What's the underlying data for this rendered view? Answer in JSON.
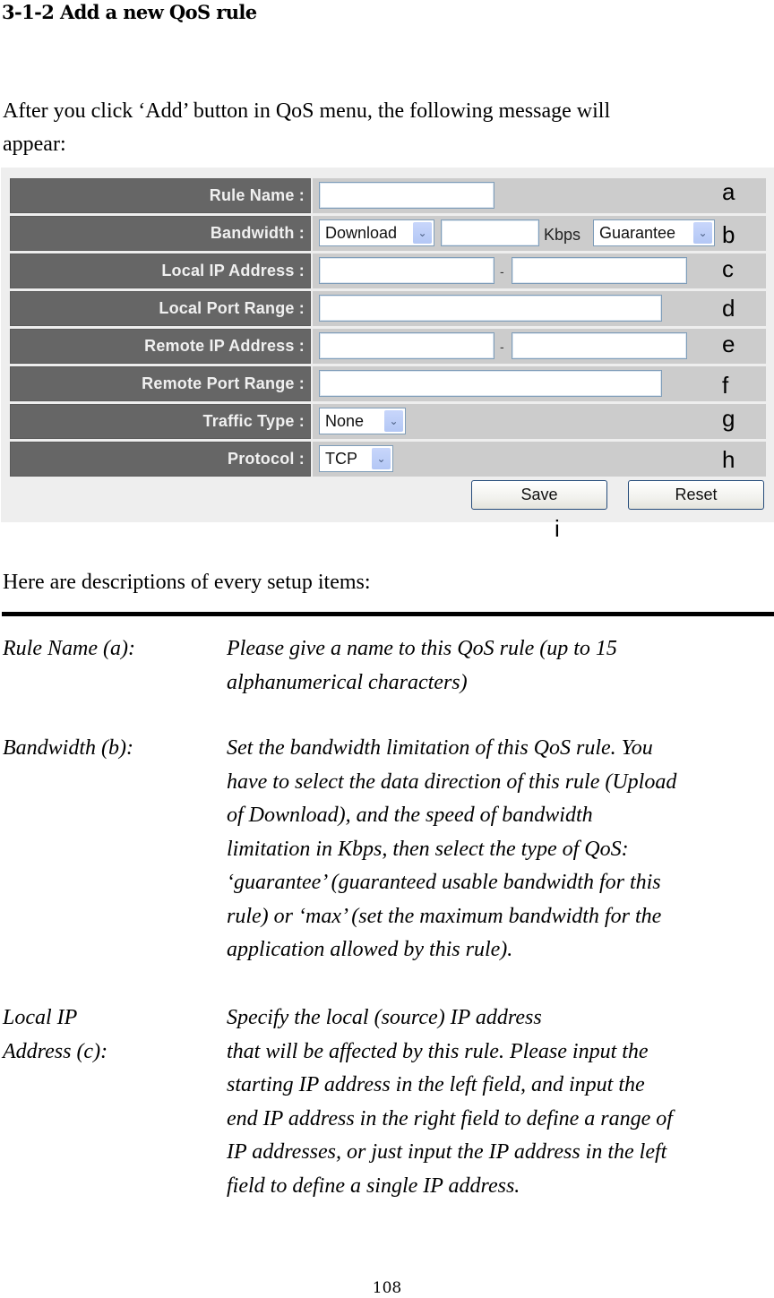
{
  "heading": "3-1-2 Add a new QoS rule",
  "intro_lines": [
    "After you click ‘Add’ button in QoS menu, the following message will",
    "appear:"
  ],
  "form": {
    "rows": [
      {
        "label": "Rule Name :",
        "marker": "a"
      },
      {
        "label": "Bandwidth :",
        "marker": "b",
        "direction_select": "Download",
        "unit": "Kbps",
        "type_select": "Guarantee"
      },
      {
        "label": "Local IP Address :",
        "marker": "c",
        "separator": "-"
      },
      {
        "label": "Local Port Range :",
        "marker": "d"
      },
      {
        "label": "Remote IP Address :",
        "marker": "e",
        "separator": "-"
      },
      {
        "label": "Remote Port Range :",
        "marker": "f"
      },
      {
        "label": "Traffic Type :",
        "marker": "g",
        "select": "None"
      },
      {
        "label": "Protocol :",
        "marker": "h",
        "select": "TCP"
      }
    ],
    "save_label": "Save",
    "reset_label": "Reset",
    "buttons_marker": "i",
    "inputs": {
      "rule_name": "",
      "bandwidth_value": "",
      "local_ip_start": "",
      "local_ip_end": "",
      "local_port_range": "",
      "remote_ip_start": "",
      "remote_ip_end": "",
      "remote_port_range": ""
    },
    "icons": {
      "dropdown": "chevron-down-icon"
    }
  },
  "descriptions_intro": "Here are descriptions of every setup items:",
  "descriptions": [
    {
      "term_lines": [
        "Rule Name (a):"
      ],
      "def_lines": [
        "Please give a name to this QoS rule (up to 15",
        "alphanumerical characters)"
      ]
    },
    {
      "term_lines": [
        "Bandwidth (b):"
      ],
      "def_lines": [
        "Set the bandwidth limitation of this QoS rule. You",
        "have to select the data direction of this rule (Upload",
        "of Download), and the speed of bandwidth",
        "limitation in Kbps, then select the type of QoS:",
        "‘guarantee’ (guaranteed usable bandwidth for this",
        "rule) or ‘max’ (set the maximum bandwidth for the",
        "application allowed by this rule)."
      ]
    },
    {
      "term_lines": [
        "Local IP",
        "Address (c):"
      ],
      "def_lines": [
        "Specify the local (source) IP address",
        "that will be affected by this rule. Please input the",
        "starting IP address in the left field, and input the",
        "end IP address in the right field to define a range of",
        "IP addresses, or just input the IP address in the left",
        "field to define a single IP address."
      ]
    }
  ],
  "page_number": "108"
}
